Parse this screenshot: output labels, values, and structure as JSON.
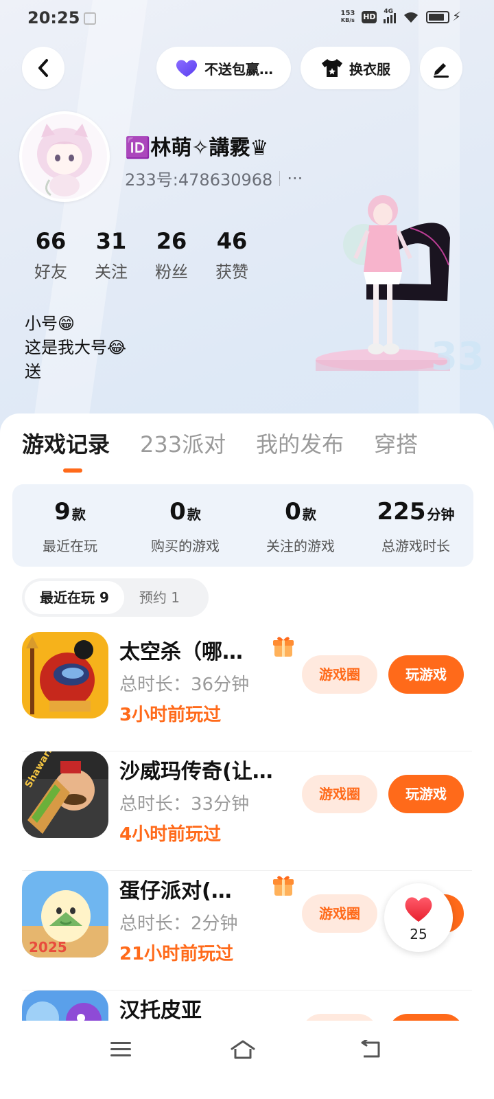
{
  "status_bar": {
    "time": "20:25",
    "net_speed_value": "153",
    "net_speed_unit": "KB/s",
    "hd_label": "HD",
    "network_label": "4G"
  },
  "header": {
    "heart_button_label": "不送包赢…",
    "clothes_button_label": "换衣服"
  },
  "profile": {
    "nickname": "🆔林萌✧講霚♛",
    "id_text": "233号:478630968",
    "more_label": "···",
    "stats": [
      {
        "value": "66",
        "label": "好友"
      },
      {
        "value": "31",
        "label": "关注"
      },
      {
        "value": "26",
        "label": "粉丝"
      },
      {
        "value": "46",
        "label": "获赞"
      }
    ],
    "bio_lines": [
      "小号😁",
      "这是我大号😂",
      "送"
    ]
  },
  "tabs": [
    "游戏记录",
    "233派对",
    "我的发布",
    "穿搭"
  ],
  "summary": [
    {
      "value": "9",
      "unit": "款",
      "label": "最近在玩"
    },
    {
      "value": "0",
      "unit": "款",
      "label": "购买的游戏"
    },
    {
      "value": "0",
      "unit": "款",
      "label": "关注的游戏"
    },
    {
      "value": "225",
      "unit": "分钟",
      "label": "总游戏时长"
    }
  ],
  "subtabs": [
    "最近在玩 9",
    "预约 1"
  ],
  "games": [
    {
      "title": "太空杀（哪…",
      "duration": "总时长：36分钟",
      "last_played": "3小时前玩过",
      "circle_label": "游戏圈",
      "play_label": "玩游戏",
      "has_gift": true
    },
    {
      "title": "沙威玛传奇(让…",
      "duration": "总时长：33分钟",
      "last_played": "4小时前玩过",
      "circle_label": "游戏圈",
      "play_label": "玩游戏",
      "has_gift": false
    },
    {
      "title": "蛋仔派对(…",
      "duration": "总时长：2分钟",
      "last_played": "21小时前玩过",
      "circle_label": "游戏圈",
      "play_label": "玩游戏",
      "has_gift": true
    },
    {
      "title": "汉托皮亚",
      "duration": "",
      "last_played": "",
      "circle_label": "",
      "play_label": "",
      "has_gift": false
    }
  ],
  "like_fab": {
    "count": "25"
  },
  "game_icon_texts": {
    "shawarma": "Shawarma",
    "year": "2025"
  },
  "colors": {
    "accent": "#ff6a1a",
    "accent_light": "#ffe9de",
    "summary_bg": "#eef3fa"
  }
}
